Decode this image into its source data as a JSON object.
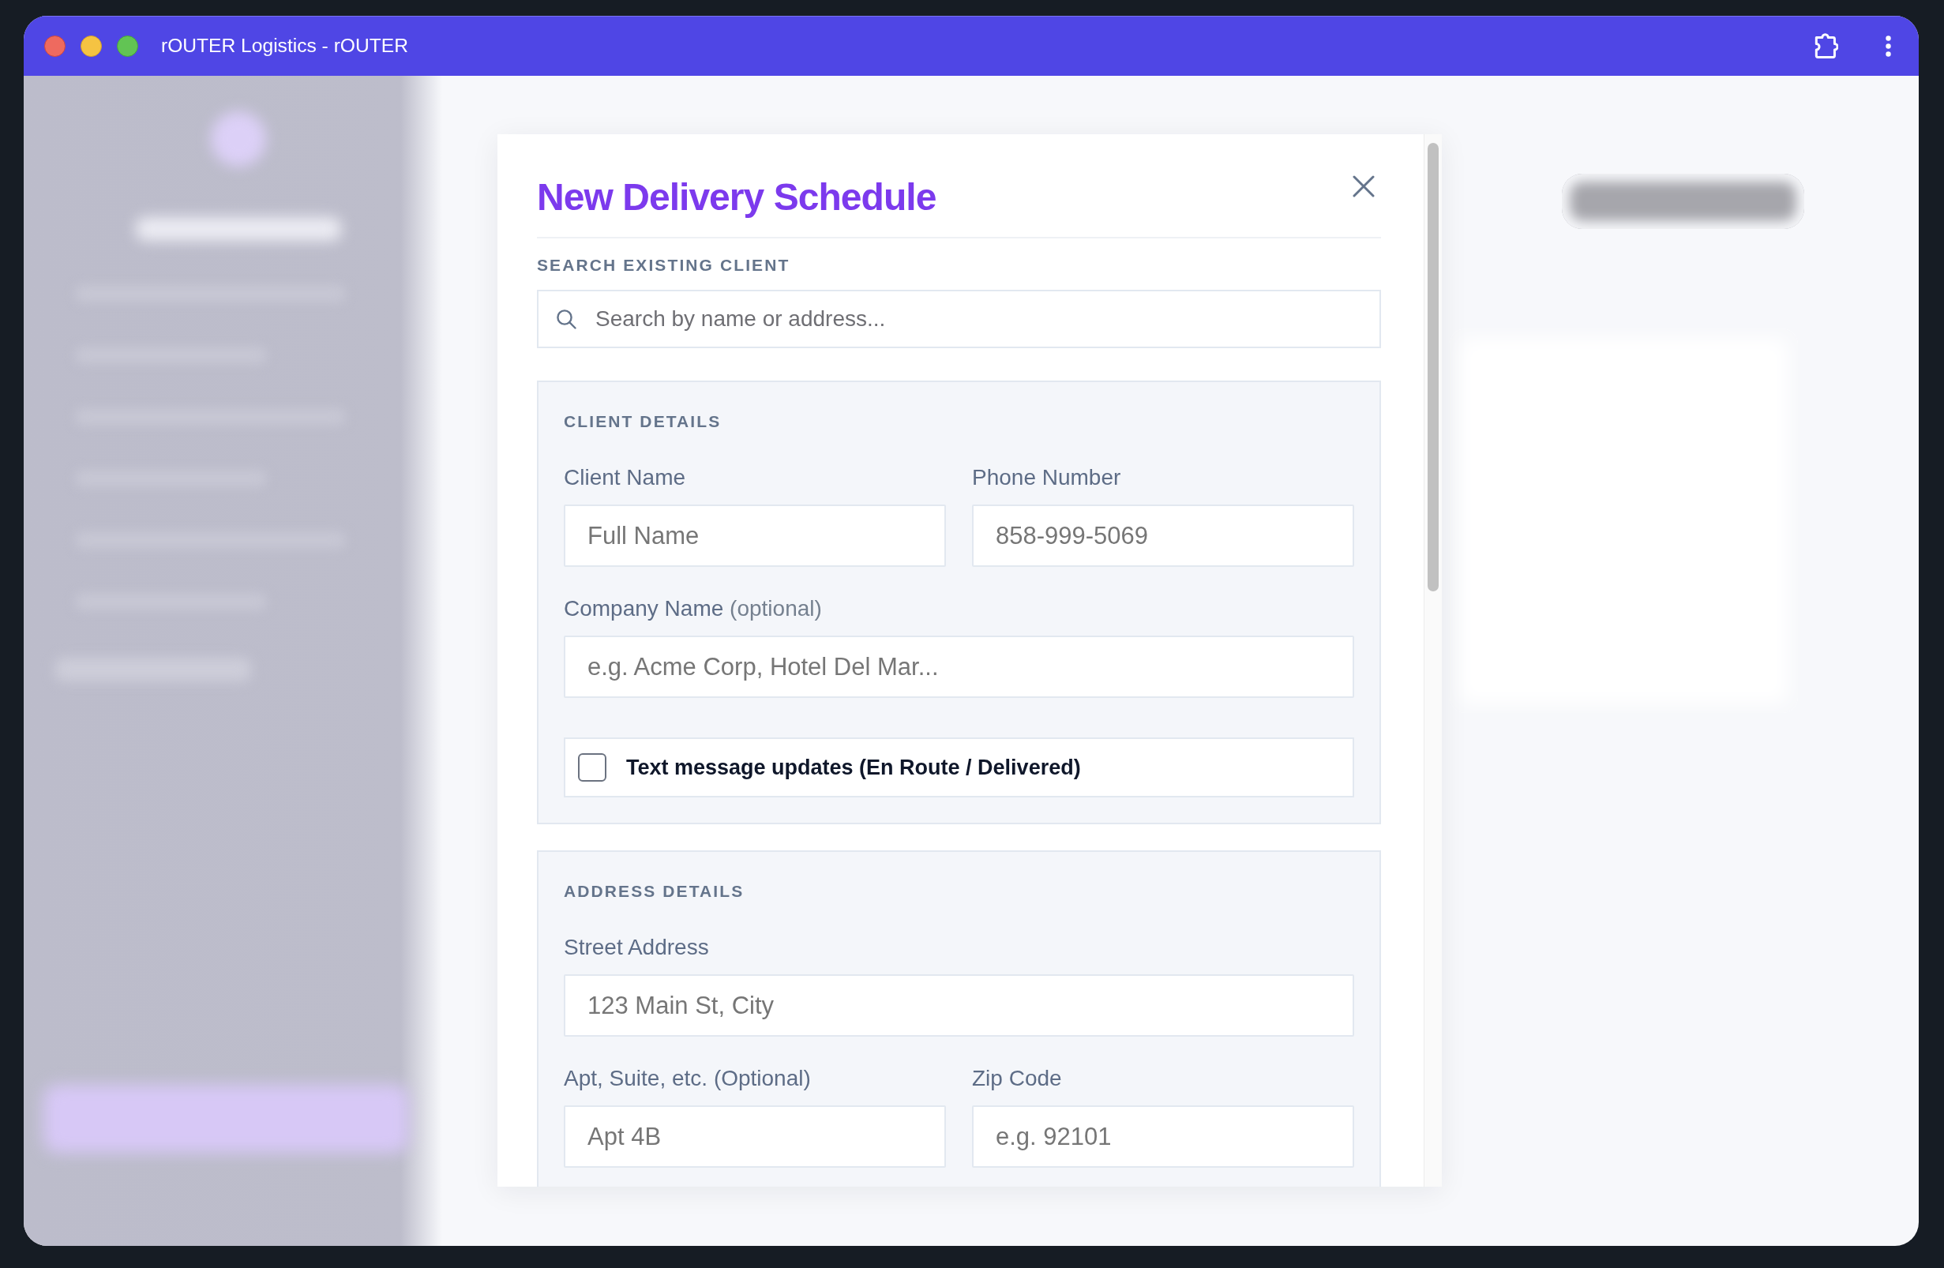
{
  "window": {
    "title": "rOUTER Logistics - rOUTER"
  },
  "modal": {
    "title": "New Delivery Schedule",
    "search": {
      "label": "SEARCH EXISTING CLIENT",
      "placeholder": "Search by name or address..."
    },
    "sections": [
      {
        "heading": "CLIENT DETAILS",
        "rows": [
          {
            "fields": [
              {
                "kind": "input",
                "label": "Client Name",
                "placeholder": "Full Name"
              },
              {
                "kind": "input",
                "label": "Phone Number",
                "placeholder": "858-999-5069"
              }
            ]
          },
          {
            "fields": [
              {
                "kind": "input",
                "label": "Company Name",
                "note": "(optional)",
                "placeholder": "e.g. Acme Corp, Hotel Del Mar..."
              }
            ]
          },
          {
            "fields": [
              {
                "kind": "checkbox",
                "label": "Text message updates (En Route / Delivered)",
                "checked": false
              }
            ]
          }
        ]
      },
      {
        "heading": "ADDRESS DETAILS",
        "rows": [
          {
            "fields": [
              {
                "kind": "input",
                "label": "Street Address",
                "placeholder": "123 Main St, City"
              }
            ]
          },
          {
            "fields": [
              {
                "kind": "input",
                "label": "Apt, Suite, etc. (Optional)",
                "placeholder": "Apt 4B"
              },
              {
                "kind": "input",
                "label": "Zip Code",
                "placeholder": "e.g. 92101"
              }
            ]
          }
        ]
      }
    ]
  }
}
